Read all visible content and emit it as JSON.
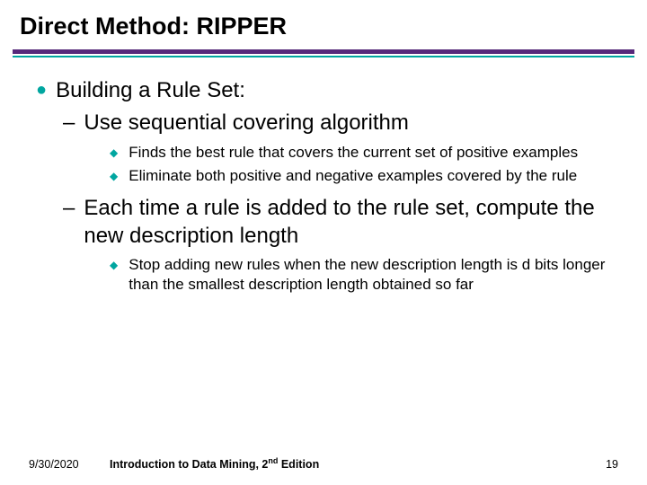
{
  "title": "Direct Method: RIPPER",
  "content": {
    "l1": "Building a Rule Set:",
    "l2a": "Use sequential covering algorithm",
    "l3a": "Finds the best rule that covers the current set of positive examples",
    "l3b": "Eliminate both positive and negative examples covered by the rule",
    "l2b": "Each time a rule is added to the rule set, compute the new description length",
    "l3c": "Stop adding new rules when the new description length is d bits longer than the smallest description length obtained so far"
  },
  "footer": {
    "date": "9/30/2020",
    "book_prefix": "Introduction to Data Mining, 2",
    "book_sup": "nd",
    "book_suffix": " Edition",
    "page": "19"
  },
  "chart_data": null
}
